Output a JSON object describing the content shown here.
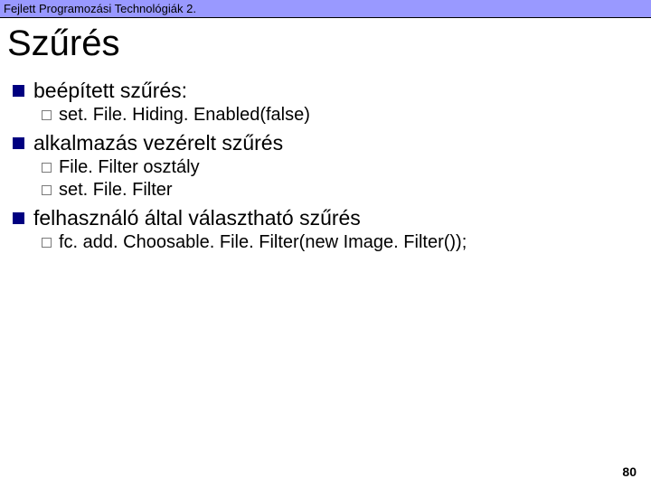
{
  "header": "Fejlett Programozási Technológiák 2.",
  "title": "Szűrés",
  "items": [
    {
      "label": "beépített szűrés:",
      "children": [
        {
          "label": "set. File. Hiding. Enabled(false)"
        }
      ]
    },
    {
      "label": "alkalmazás vezérelt szűrés",
      "children": [
        {
          "label": "File. Filter osztály"
        },
        {
          "label": "set. File. Filter"
        }
      ]
    },
    {
      "label": "felhasználó által választható szűrés",
      "children": [
        {
          "label": "fc. add. Choosable. File. Filter(new Image. Filter());"
        }
      ]
    }
  ],
  "page_number": "80"
}
